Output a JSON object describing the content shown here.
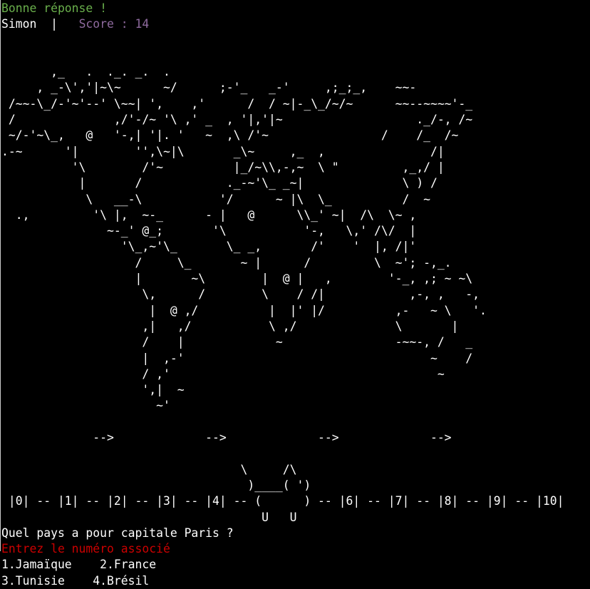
{
  "status": {
    "message": "Bonne réponse !",
    "color": "#6ab04c"
  },
  "player": {
    "name": "Simon",
    "separator": "  |   ",
    "score_label": "Score : 14",
    "score_color": "#8e6a9e"
  },
  "world_map": {
    "art": "\n\n       ,_   .  ._. _.  .\n     , _-\\','|~\\~      ~/      ;-'_   _-'     ,;_;_,    ~~-\n /~~-\\_/-'~'--' \\~~| ',    ,'      /  / ~|-_\\_/~/~      ~~--~~~~'-_\n /              ,/'-/~ '\\ ,' _  , '|,'|~                   ._/-, /~\n ~/-'~\\_,   @   '-,| '|. '   ~  ,\\ /'~                /    /_  /~\n.-~      '|        '',\\~|\\       _\\~     ,_  ,               /|\n          '\\        /'~          |_/~\\\\,-,~  \\ \"         ,_,/ |\n           |       /            ._-~'\\_ _~|              \\ ) /\n            \\   __-\\           '/      ~ |\\  \\_          /  ~\n  .,         '\\ |,  ~-_      - |   @      \\\\_' ~|  /\\  \\~ ,\n               ~-_' @_;       '\\           '-,   \\,' /\\/  |\n                 '\\_,~'\\_       \\_ _,       /'    '  |, /|'\n                   /     \\_       ~ |      /         \\  ~'; -,_.\n                   |       ~\\        |  @ |   ,        '-_, ,; ~ ~\\\n                    \\,      /        \\    / /|            ,-, ,   -,\n                     |  @ ,/          |  |' |/          ,-   ~ \\   '.\n                    ,|   ,/           \\ ,/              \\       |\n                    /    |             ~                -~~-, /   _\n                    |  ,-'                                   ~    /\n                    / ,'                                      ~\n                    ',|  ~\n                      ~'\n\n"
  },
  "timeline": {
    "arrows": "             -->             -->             -->             -->",
    "gap": "",
    "mascot_top": "                                  \\     /\\",
    "mascot_mid": "                                   )____( ')",
    "track": " |0| -- |1| -- |2| -- |3| -- |4| -- (      ) -- |6| -- |7| -- |8| -- |9| -- |10|",
    "mascot_feet": "                                     U   U"
  },
  "question": {
    "text": "Quel pays a pour capitale Paris ?",
    "prompt": "Entrez le numéro associé",
    "prompt_color": "#cc0000"
  },
  "options": {
    "row1": "1.Jamaïque    2.France",
    "row2": "3.Tunisie    4.Brésil"
  }
}
